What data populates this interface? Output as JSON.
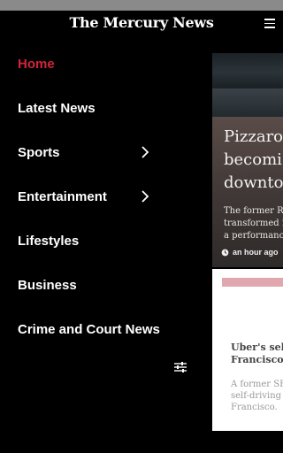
{
  "app": {
    "masthead": "The Mercury News"
  },
  "drawer": {
    "items": [
      {
        "label": "Home",
        "active": true,
        "has_submenu": false
      },
      {
        "label": "Latest News",
        "active": false,
        "has_submenu": false
      },
      {
        "label": "Sports",
        "active": false,
        "has_submenu": true
      },
      {
        "label": "Entertainment",
        "active": false,
        "has_submenu": true
      },
      {
        "label": "Lifestyles",
        "active": false,
        "has_submenu": false
      },
      {
        "label": "Business",
        "active": false,
        "has_submenu": false
      },
      {
        "label": "Crime and Court News",
        "active": false,
        "has_submenu": false
      }
    ]
  },
  "feed": {
    "story1": {
      "headline": "Pizzaro\nbecomi\ndownto",
      "dek": "The former R\ntransformed i\na performanc",
      "time": "an hour ago"
    },
    "story2": {
      "headline": "Uber's self-\nFrancisco ca",
      "dek": "A former SF c\nself-driving c\nFrancisco."
    }
  },
  "colors": {
    "accent": "#d0243a",
    "background": "#000000",
    "text": "#ffffff"
  },
  "icons": {
    "menu": "hamburger-icon",
    "chevron": "chevron-right-icon",
    "settings": "sliders-icon",
    "clock": "clock-icon"
  }
}
